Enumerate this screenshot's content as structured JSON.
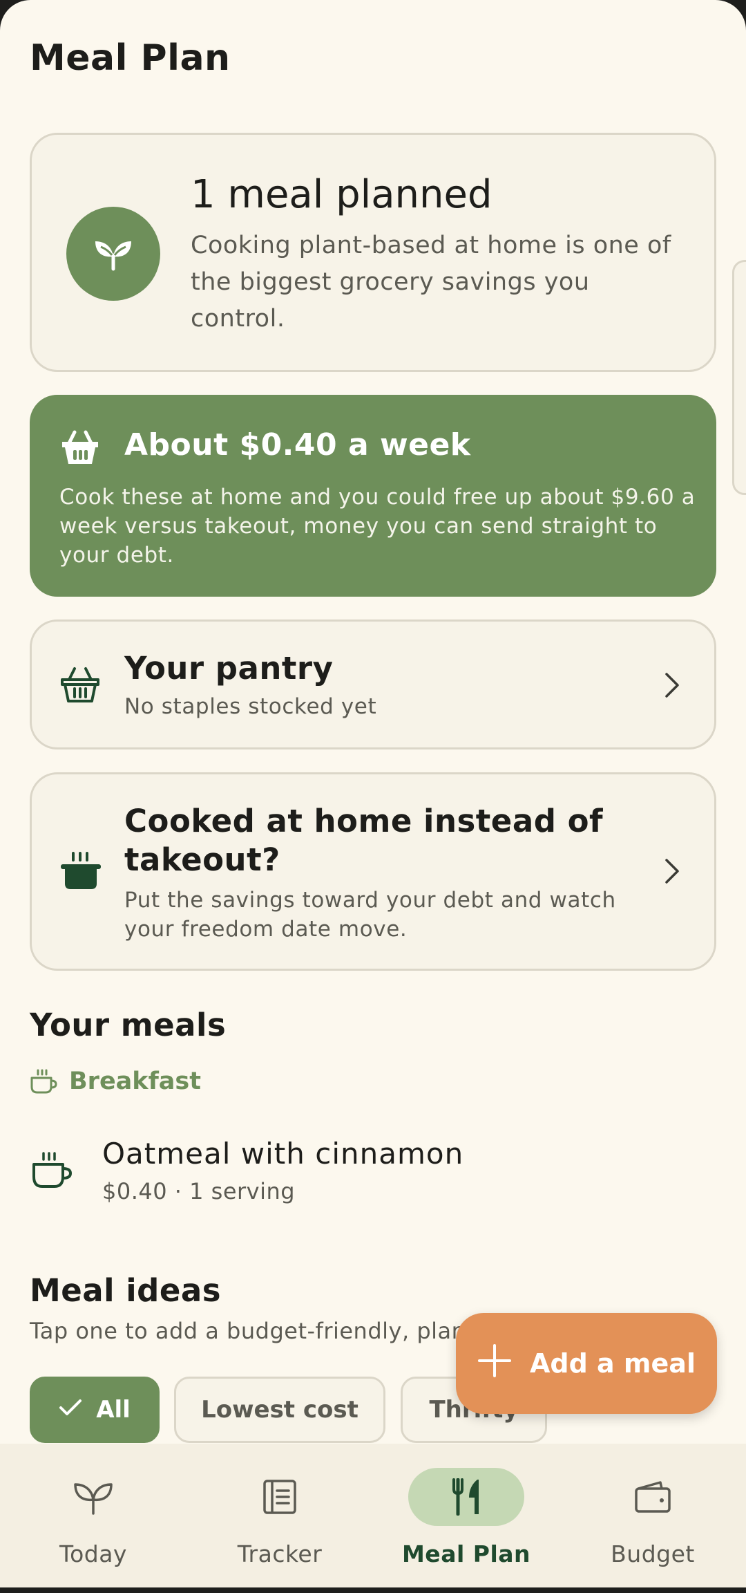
{
  "header": {
    "title": "Meal Plan"
  },
  "summary": {
    "count_text": "1 meal planned",
    "description": "Cooking plant-based at home is one of the biggest grocery savings you control.",
    "icon": "sprout-icon"
  },
  "savings": {
    "headline": "About $0.40 a week",
    "body": "Cook these at home and you could free up about $9.60 a week versus takeout, money you can send straight to your debt.",
    "icon": "basket-icon"
  },
  "pantry": {
    "title": "Your pantry",
    "subtitle": "No staples stocked yet",
    "icon": "basket-icon"
  },
  "cooked": {
    "title": "Cooked at home instead of takeout?",
    "subtitle": "Put the savings toward your debt and watch your freedom date move.",
    "icon": "pot-icon"
  },
  "meals": {
    "section_title": "Your meals",
    "groups": [
      {
        "label": "Breakfast",
        "icon": "coffee-cup-icon",
        "items": [
          {
            "name": "Oatmeal with cinnamon",
            "meta": "$0.40 · 1 serving",
            "icon": "coffee-cup-icon"
          }
        ]
      }
    ]
  },
  "ideas": {
    "title": "Meal ideas",
    "subtitle": "Tap one to add a budget-friendly, plant",
    "filters": [
      {
        "label": "All",
        "selected": true
      },
      {
        "label": "Lowest cost",
        "selected": false
      },
      {
        "label": "Thrifty",
        "selected": false
      }
    ]
  },
  "fab": {
    "label": "Add a meal",
    "icon": "plus-icon"
  },
  "nav": {
    "items": [
      {
        "label": "Today",
        "icon": "sprout-icon",
        "active": false
      },
      {
        "label": "Tracker",
        "icon": "list-icon",
        "active": false
      },
      {
        "label": "Meal Plan",
        "icon": "fork-knife-icon",
        "active": true
      },
      {
        "label": "Budget",
        "icon": "wallet-icon",
        "active": false
      }
    ]
  },
  "colors": {
    "background": "#fcf8ee",
    "accent_green": "#6e8f5a",
    "fab_orange": "#e39157",
    "dark_green": "#1f4a2e"
  }
}
